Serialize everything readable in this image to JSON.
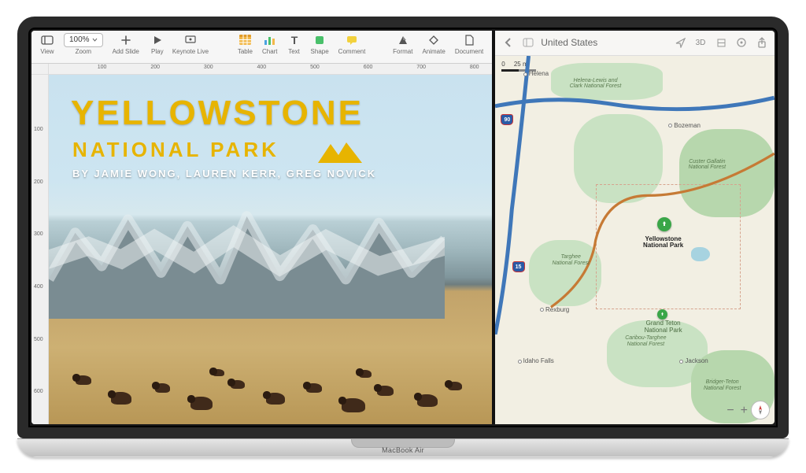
{
  "device": {
    "brand": "MacBook Air"
  },
  "keynote": {
    "toolbar": {
      "view": "View",
      "zoom_value": "100%",
      "zoom_label": "Zoom",
      "add_slide": "Add Slide",
      "play": "Play",
      "keynote_live": "Keynote Live",
      "table": "Table",
      "chart": "Chart",
      "text": "Text",
      "shape": "Shape",
      "comment": "Comment",
      "format": "Format",
      "animate": "Animate",
      "document": "Document"
    },
    "ruler": {
      "h_ticks": [
        "100",
        "200",
        "300",
        "400",
        "500",
        "600",
        "700",
        "800"
      ],
      "v_ticks": [
        "100",
        "200",
        "300",
        "400",
        "500",
        "600"
      ]
    },
    "slide": {
      "title": "YELLOWSTONE",
      "subtitle": "NATIONAL PARK",
      "byline": "BY JAMIE WONG, LAUREN KERR, GREG NOVICK"
    }
  },
  "maps": {
    "location_title": "United States",
    "buttons": {
      "mode_3d": "3D"
    },
    "scale": {
      "left": "0",
      "right": "25 mi"
    },
    "cities": {
      "helena": "Helena",
      "bozeman": "Bozeman",
      "rexburg": "Rexburg",
      "idaho_falls": "Idaho Falls",
      "jackson": "Jackson"
    },
    "forests": {
      "helena_lc": "Helena-Lewis and Clark National Forest",
      "custer": "Custer Gallatin National Forest",
      "targhee": "Targhee National Forest",
      "caribou": "Caribou-Targhee National Forest",
      "bridger": "Bridger-Teton National Forest"
    },
    "parks": {
      "yellowstone": "Yellowstone National Park",
      "grand_teton": "Grand Teton National Park"
    },
    "shields": {
      "i90": "90",
      "i15": "15"
    }
  }
}
